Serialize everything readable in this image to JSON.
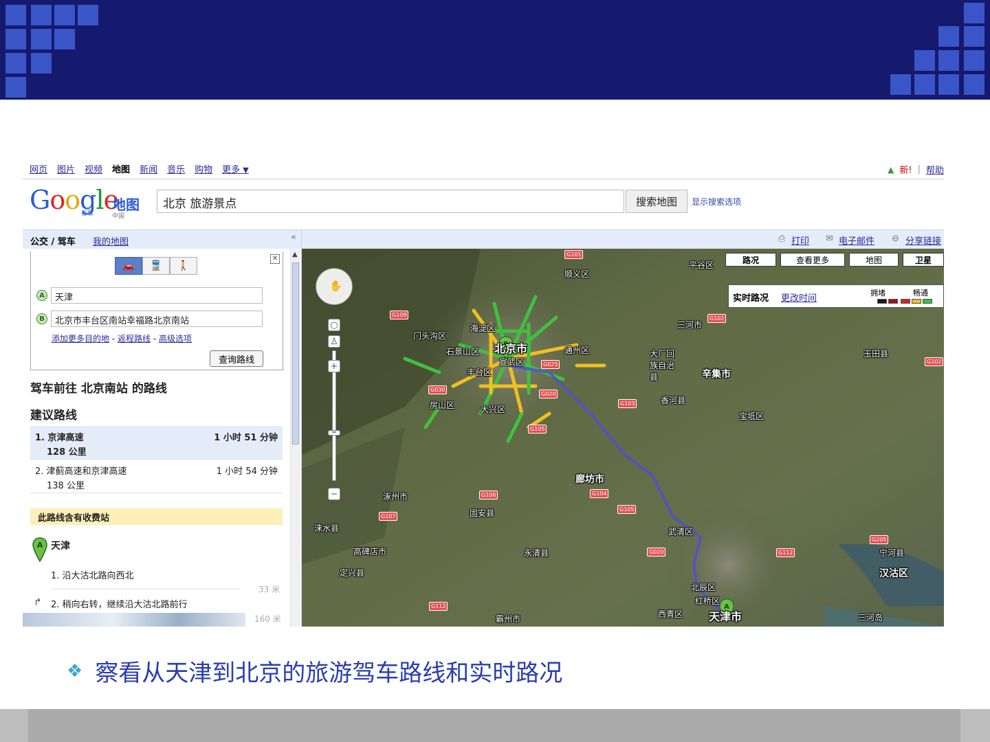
{
  "nav": {
    "items": [
      "网页",
      "图片",
      "视频",
      "地图",
      "新闻",
      "音乐",
      "购物",
      "更多"
    ],
    "more_caret": "▼",
    "new_label": "新!",
    "help_label": "帮助"
  },
  "logo": {
    "wordmark": [
      "G",
      "o",
      "o",
      "g",
      "l",
      "e"
    ],
    "small": "谷歌",
    "product": "地图",
    "region": "中国"
  },
  "search": {
    "query": "北京  旅游景点",
    "button_label": "搜索地图",
    "options_label": "显示搜索选项"
  },
  "left_panel": {
    "tab_active": "公交 / 驾车",
    "tab_mymaps": "我的地图",
    "collapse": "«",
    "mode_icons": [
      "car-icon",
      "train-icon",
      "walk-icon"
    ],
    "waypoint_a": {
      "badge": "A",
      "value": "天津"
    },
    "waypoint_b": {
      "badge": "B",
      "value": "北京市丰台区南站幸福路北京南站"
    },
    "link_add": "添加更多目的地",
    "link_return": "返程路线",
    "link_advanced": "高级选项",
    "sep": "-",
    "query_button": "查询路线",
    "route_title": "驾车前往  北京南站  的路线",
    "suggested": "建议路线",
    "routes": [
      {
        "name": "1. 京津高速",
        "duration": "1 小时  51 分钟",
        "distance": "128 公里"
      },
      {
        "name": "2. 津蓟高速和京津高速",
        "duration": "1 小时  54 分钟",
        "distance": "138 公里"
      }
    ],
    "toll_notice": "此路线含有收费站",
    "start": "天津",
    "step1": "1. 沿大沽北路向西北",
    "step1_dist": "33 米",
    "step2": "2. 稍向右转，继续沿大沽北路前行",
    "step2_dist": "160 米"
  },
  "map_toolbar": {
    "print": "打印",
    "email": "电子邮件",
    "share": "分享链接"
  },
  "map_types": [
    "路况",
    "查看更多",
    "地图",
    "卫星"
  ],
  "traffic": {
    "title": "实时路况",
    "change_time": "更改时间",
    "legend_jam": "拥堵",
    "legend_free": "畅通",
    "colors": [
      "#1a1a1a",
      "#a01010",
      "#e02020",
      "#f0c020",
      "#40c040"
    ]
  },
  "map_labels": {
    "districts": [
      "顺义区",
      "平谷区",
      "三河市",
      "门头沟区",
      "海淀区",
      "北京市",
      "石景山区",
      "宣武区",
      "丰台区",
      "通州区",
      "大厂回族自治县",
      "玉田县",
      "香河县",
      "房山区",
      "大兴区",
      "宝坻区",
      "廊坊市",
      "涿州市",
      "固安县",
      "涞水县",
      "武清区",
      "高碑店市",
      "永清县",
      "宁河县",
      "汉沽区",
      "定兴县",
      "北辰区",
      "红桥区",
      "西青区",
      "天津市",
      "霸州市",
      "三河岛",
      "辛集市"
    ],
    "roads": [
      "G101",
      "G109",
      "G102",
      "G025",
      "G020",
      "G030",
      "G103",
      "G105",
      "G106",
      "G104",
      "G107",
      "G105",
      "G020",
      "G112",
      "G205",
      "G112",
      "G102"
    ]
  },
  "caption": {
    "bullet": "❖",
    "text": "察看从天津到北京的旅游驾车路线和实时路况"
  }
}
